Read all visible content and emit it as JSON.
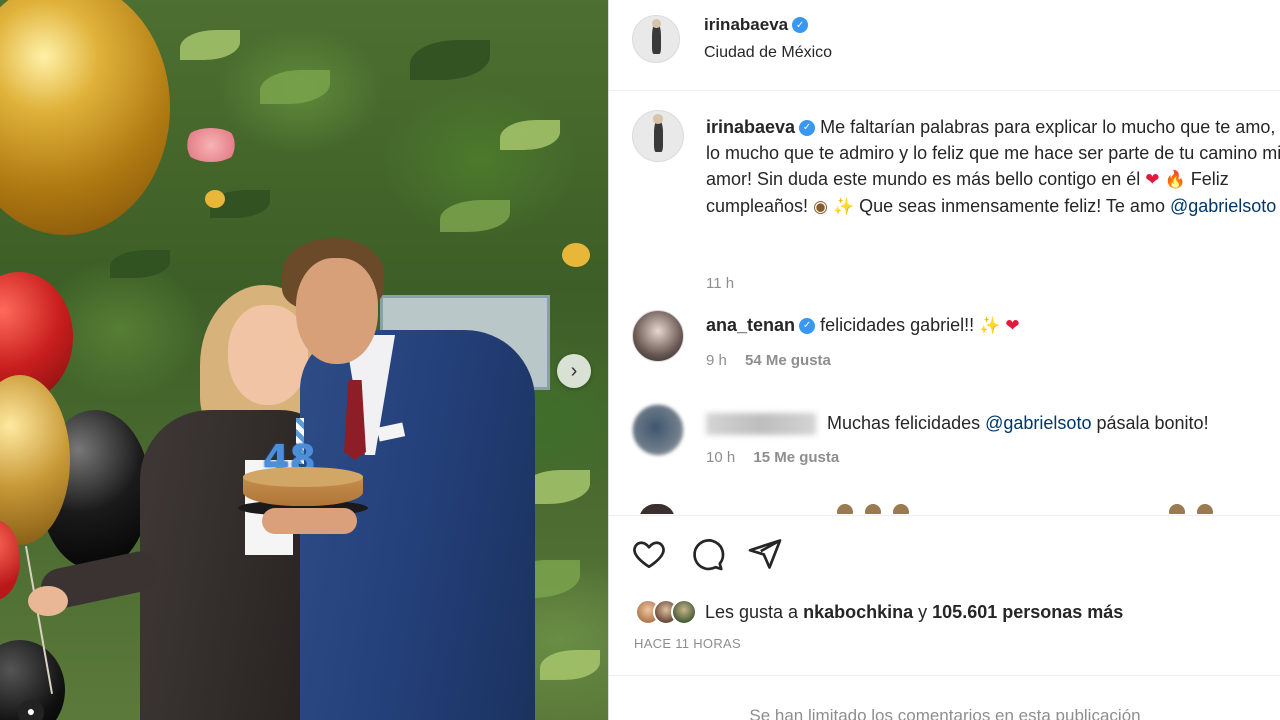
{
  "post_header": {
    "username": "irinabaeva",
    "verified": true,
    "location": "Ciudad de México"
  },
  "caption": {
    "username": "irinabaeva",
    "text_1": "Me faltarían palabras para explicar lo mucho que te amo, lo mucho que te admiro y lo feliz que me hace ser parte de tu camino mi amor! Sin duda este mundo es más bello contigo en él",
    "text_2": "Feliz cumpleaños!",
    "text_3": "Que seas inmensamente feliz! Te amo",
    "mention": "@gabrielsoto",
    "time": "11 h"
  },
  "comments": [
    {
      "username": "ana_tenan",
      "verified": true,
      "text": "felicidades gabriel!!",
      "time": "9 h",
      "likes": "54 Me gusta"
    },
    {
      "username": "",
      "verified": false,
      "text_1": "Muchas felicidades",
      "mention": "@gabrielsoto",
      "text_2": "pásala bonito!",
      "time": "10 h",
      "likes": "15 Me gusta"
    }
  ],
  "likes_summary": {
    "prefix": "Les gusta a",
    "first_liker": "nkabochkina",
    "joiner": "y",
    "others": "105.601 personas más"
  },
  "time_ago": "HACE 11 HORAS",
  "comments_limited": "Se han limitado los comentarios en esta publicación",
  "icons": {
    "like": "heart-outline-icon",
    "comment": "speech-bubble-icon",
    "share": "paper-plane-icon",
    "next": "chevron-right-icon",
    "verified": "verified-badge-icon"
  },
  "photo_candles": "48",
  "colors": {
    "verified": "#3897f0",
    "mention": "#00376b",
    "secondary_text": "#8e8e8e",
    "heart": "#e3193b"
  }
}
